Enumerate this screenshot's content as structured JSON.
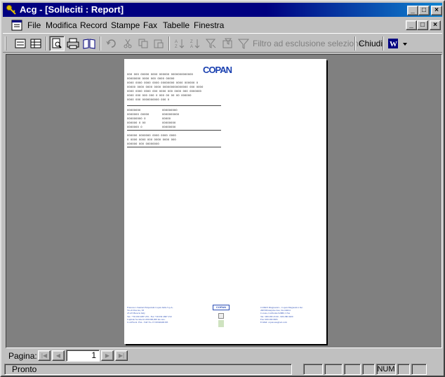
{
  "window": {
    "title": "Acg - [Solleciti : Report]"
  },
  "titlebar_buttons": {
    "minimize": "_",
    "maximize": "□",
    "close": "×"
  },
  "menu": {
    "items": [
      "File",
      "Modifica",
      "Record",
      "Stampe",
      "Fax",
      "Tabelle",
      "Finestra"
    ]
  },
  "toolbar": {
    "filter_label": "Filtro ad esclusione selezione",
    "close_label": "Chiudi"
  },
  "report": {
    "logo": "COPAN",
    "body_lines": [
      "ooo ooo ooooo oooo oooooo ooooooooooooo",
      "oooooooo oooo ooo oooo ooooo",
      "oooo oooo oooo oooo oooooooo oooo oooooo o",
      "ooooo oooo oooo oooo ooooooooooooooo ooo oooo",
      "oooo oooo oooo ooo oooo ooo oooo ooo ooooooo",
      "oooo ooo ooo ooo o ooo oo oo oo oooooo",
      "oooo ooo oooooooooo ooo o"
    ],
    "table_left": [
      "oooooooo",
      "ooooooo ooooo",
      "ooooooooo o",
      "oooooo  o oo",
      "ooooooo o"
    ],
    "table_right": [
      "ooooooooo",
      "oooooooooo",
      "ooooo",
      "oooooooo",
      "oooooooo"
    ],
    "closing_lines": [
      "oooooo ooooooo oooo oooo oooo",
      "o oooo oooo ooo oooo oooo ooo",
      "oooooo ooo oooooooo"
    ],
    "footer_left": "Francesco Sanitari Emporium Copan Italia S.p.A.\nVia di Pescolo, 58\n25125 Brescia Italy\nTel.: +39 030 2687 259 - Fax +39 030 2687 250\nCapitale Sociale €1.000.000,000 int.vers.\nCod.Fiscal. IVA - VAT No. IT 00340400183",
    "footer_center": "COPAN",
    "footer_right": "COPAN Diagnostics - Copan Diagnostics Inc.\n26055Enterprise Ave, Ste #4024\nCorona, California 92880, USA\nTel.: 909 280 43 60 - 909 280 0200\nFax: 909 280 9835\nE-Mail: copan.usa@aol.com"
  },
  "pagination": {
    "label": "Pagina:",
    "current_page": "1",
    "first": "|◀",
    "prev": "◀",
    "next": "▶",
    "last": "▶|"
  },
  "status": {
    "text": "Pronto",
    "num": "NUM"
  }
}
